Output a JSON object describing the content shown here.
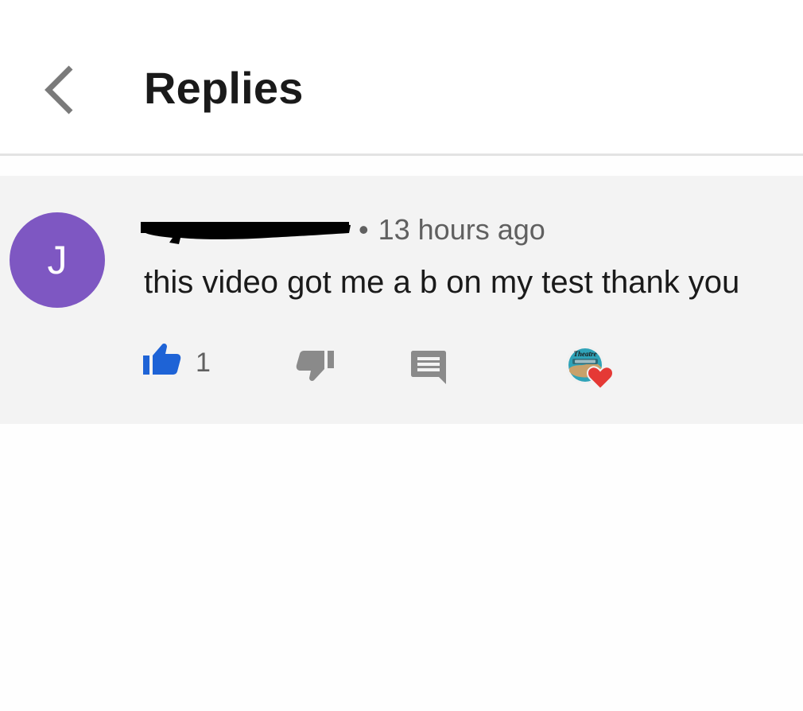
{
  "header": {
    "title": "Replies",
    "back_icon": "chevron-left-icon"
  },
  "comment": {
    "avatar_letter": "J",
    "avatar_color": "#7e57c2",
    "author_redacted": true,
    "separator": "•",
    "timestamp": "13 hours ago",
    "text": "this video got me a b on my test thank you",
    "like_count": "1",
    "like_color": "#1e63d6",
    "icon_gray": "#8a8a8a",
    "heart_color": "#e53935",
    "creator_badge_text": "Theatre"
  }
}
